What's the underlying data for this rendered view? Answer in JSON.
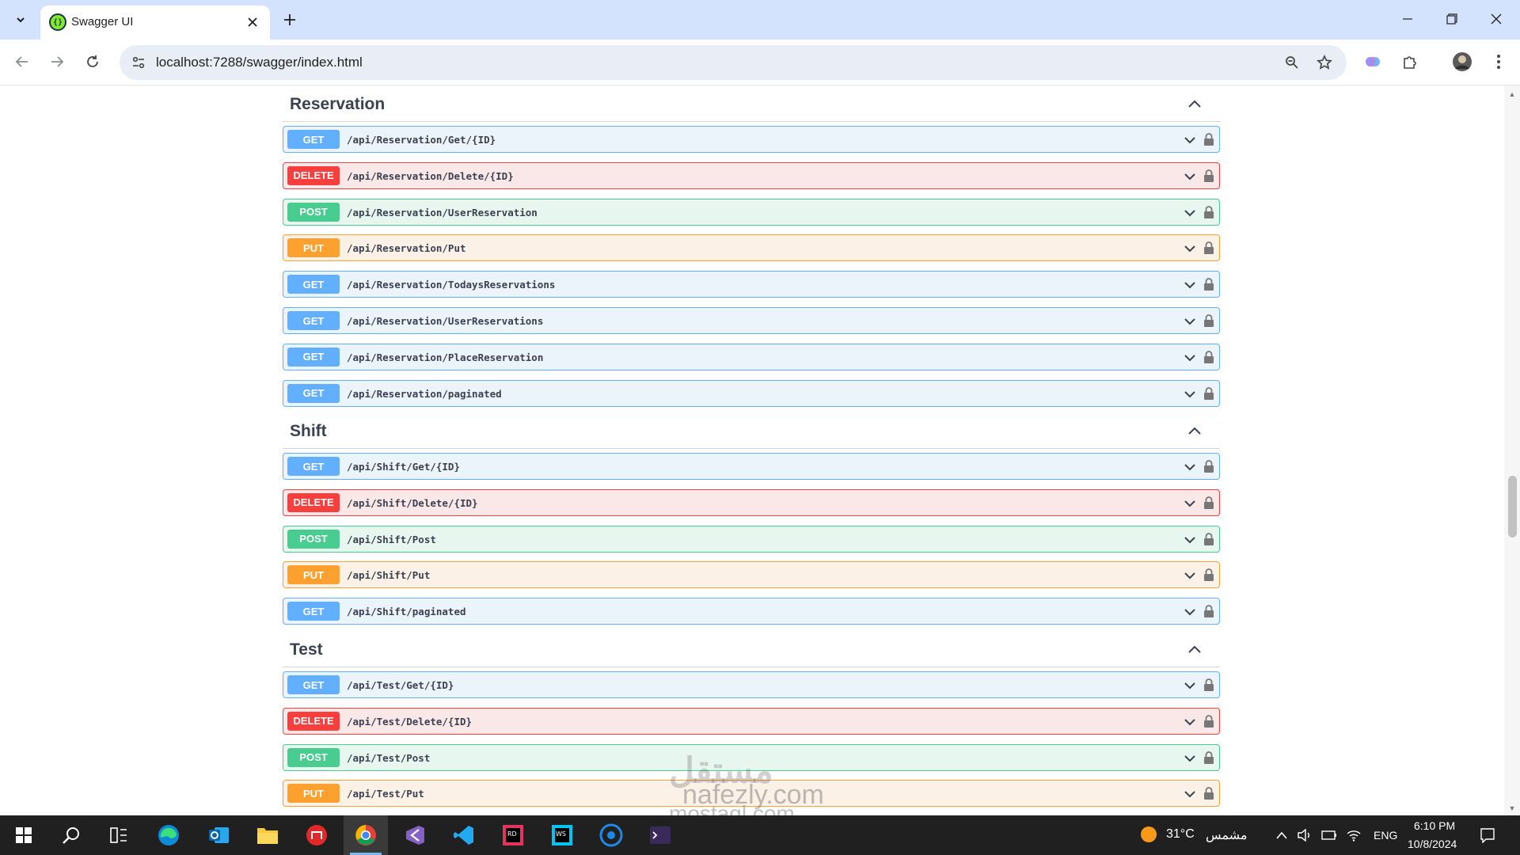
{
  "browser": {
    "tab_title": "Swagger UI",
    "tab_favicon": "{}",
    "url": "localhost:7288/swagger/index.html",
    "icons": [
      "tab-search-icon",
      "close-icon",
      "plus-icon",
      "back-icon",
      "forward-icon",
      "reload-icon",
      "site-info-icon",
      "zoom-icon",
      "star-icon",
      "extension-icon",
      "puzzle-icon",
      "profile-avatar",
      "menu-icon",
      "minimize-icon",
      "restore-icon",
      "close-window-icon"
    ]
  },
  "groups": [
    {
      "title": "Reservation",
      "operations": [
        {
          "method": "GET",
          "path": "/api/Reservation/Get/{ID}"
        },
        {
          "method": "DELETE",
          "path": "/api/Reservation/Delete/{ID}"
        },
        {
          "method": "POST",
          "path": "/api/Reservation/UserReservation"
        },
        {
          "method": "PUT",
          "path": "/api/Reservation/Put"
        },
        {
          "method": "GET",
          "path": "/api/Reservation/TodaysReservations"
        },
        {
          "method": "GET",
          "path": "/api/Reservation/UserReservations"
        },
        {
          "method": "GET",
          "path": "/api/Reservation/PlaceReservation"
        },
        {
          "method": "GET",
          "path": "/api/Reservation/paginated"
        }
      ]
    },
    {
      "title": "Shift",
      "operations": [
        {
          "method": "GET",
          "path": "/api/Shift/Get/{ID}"
        },
        {
          "method": "DELETE",
          "path": "/api/Shift/Delete/{ID}"
        },
        {
          "method": "POST",
          "path": "/api/Shift/Post"
        },
        {
          "method": "PUT",
          "path": "/api/Shift/Put"
        },
        {
          "method": "GET",
          "path": "/api/Shift/paginated"
        }
      ]
    },
    {
      "title": "Test",
      "operations": [
        {
          "method": "GET",
          "path": "/api/Test/Get/{ID}"
        },
        {
          "method": "DELETE",
          "path": "/api/Test/Delete/{ID}"
        },
        {
          "method": "POST",
          "path": "/api/Test/Post"
        },
        {
          "method": "PUT",
          "path": "/api/Test/Put"
        }
      ]
    }
  ],
  "colors": {
    "get": "#61affe",
    "delete": "#f93e3e",
    "post": "#49cc90",
    "put": "#fca130"
  },
  "watermark": {
    "line1": "مستقل",
    "line2": "nafezly.com",
    "line3": "mostaql.com"
  },
  "taskbar": {
    "weather_temp": "31°C",
    "weather_label": "مشمس",
    "language": "ENG",
    "time": "6:10 PM",
    "date": "10/8/2024"
  }
}
